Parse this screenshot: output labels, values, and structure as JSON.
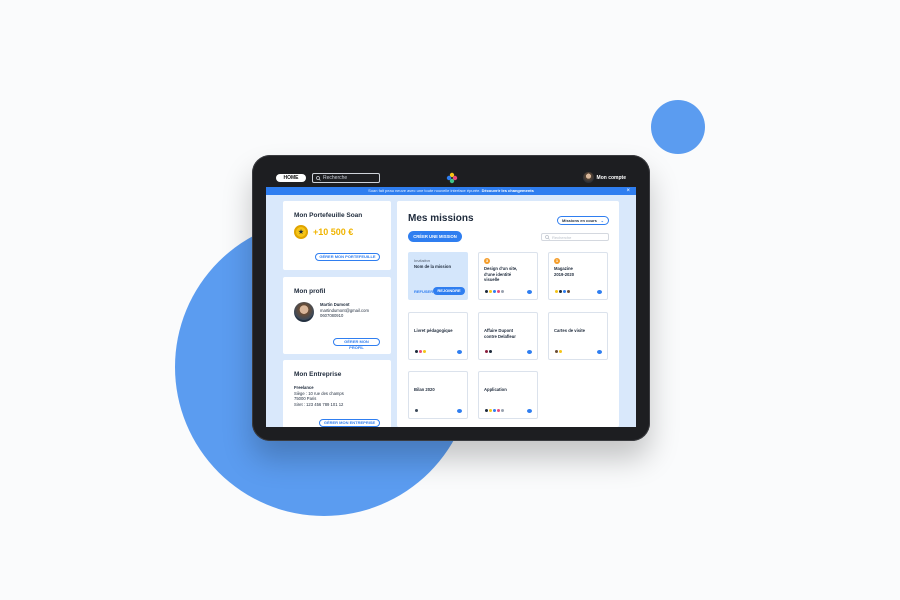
{
  "topbar": {
    "home_label": "HOME",
    "search_placeholder": "Recherche",
    "account_label": "Mon compte"
  },
  "banner": {
    "text": "Soan fait peau neuve avec une toute nouvelle interface épurée.",
    "link": "Découvrir les changements",
    "close": "×"
  },
  "wallet": {
    "title": "Mon Portefeuille Soan",
    "amount": "+10 500 €",
    "button": "GÉRER MON PORTEFEUILLE"
  },
  "profile": {
    "title": "Mon profil",
    "name": "Martin Dumont",
    "email": "martindumont@gmail.com",
    "phone": "0607080910",
    "button": "GÉRER MON PROFIL"
  },
  "company": {
    "title": "Mon Entreprise",
    "type": "Freelance",
    "address1": "Siège : 10 rue des champs",
    "address2": "75000 Paris",
    "siret": "Siret : 123 456 789 101 12",
    "button": "GÉRER MON ENTREPRISE"
  },
  "missions": {
    "title": "Mes missions",
    "filter": "Missions en cours",
    "create_button": "CRÉER UNE MISSION",
    "search_placeholder": "Recherche",
    "invitation": {
      "label": "Invitation",
      "name": "Nom de la mission",
      "refuse": "REFUSER",
      "join": "REJOINDRE"
    },
    "cards": [
      {
        "title": "Design d'un site,\nd'une identité\nvisuelle",
        "badge": "3"
      },
      {
        "title": "Magazine\n2019-2020",
        "badge": "1"
      },
      {
        "title": "Livret pédagogique"
      },
      {
        "title": "Affaire Dupont\ncontre Delafleur"
      },
      {
        "title": "Cartes de visite"
      },
      {
        "title": "Bilan 2020"
      },
      {
        "title": "Application"
      }
    ]
  },
  "colors": {
    "accent": "#2f7ef0",
    "blob": "#5b9cf0",
    "badge": "#f59e2b",
    "amount": "#f0b400"
  }
}
